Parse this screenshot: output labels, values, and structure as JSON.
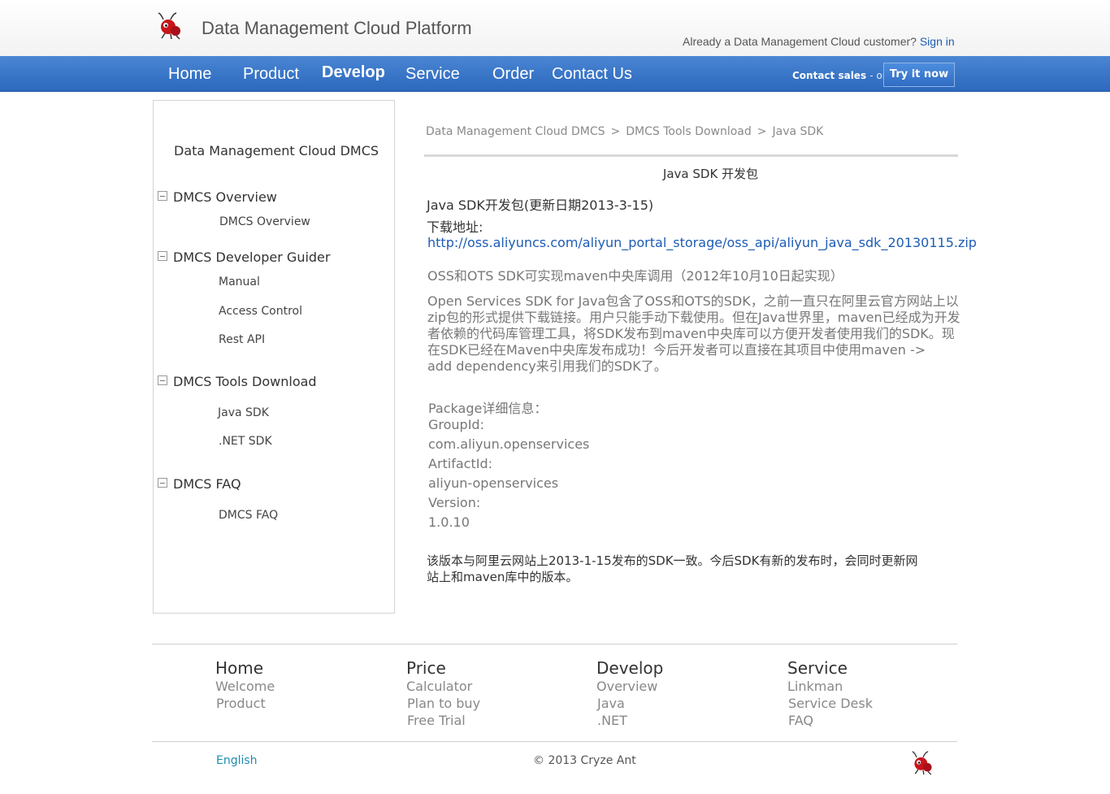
{
  "header": {
    "brand": "Data Management Cloud Platform",
    "signin_prompt": "Already a Data Management Cloud customer?",
    "signin_link": "Sign in"
  },
  "nav": {
    "items": [
      "Home",
      "Product",
      "Develop",
      "Service",
      "Order",
      "Contact Us"
    ],
    "active": "Develop",
    "contact_sales": "Contact sales",
    "or": "- or -",
    "try_button": "Try it now",
    "bar_color": "#2c68bd"
  },
  "sidebar": {
    "title": "Data Management Cloud DMCS",
    "sections": [
      {
        "label": "DMCS Overview",
        "links": [
          "DMCS Overview"
        ]
      },
      {
        "label": "DMCS Developer Guider",
        "links": [
          "Manual",
          "Access Control",
          "Rest API"
        ]
      },
      {
        "label": "DMCS Tools Download",
        "links": [
          "Java SDK",
          ".NET SDK"
        ]
      },
      {
        "label": "DMCS FAQ",
        "links": [
          "DMCS FAQ"
        ]
      }
    ]
  },
  "main": {
    "breadcrumb": [
      "Data Management Cloud DMCS",
      "DMCS Tools Download",
      "Java SDK"
    ],
    "breadcrumb_sep": ">",
    "page_title": "Java SDK 开发包",
    "package_heading": "Java SDK开发包(更新日期2013-3-15)",
    "download_label": "下载地址:",
    "download_url": "http://oss.aliyuncs.com/aliyun_portal_storage/oss_api/aliyun_java_sdk_20130115.zip",
    "maven_note": "OSS和OTS SDK可实现maven中央库调用（2012年10月10日起实现）",
    "description_lines": [
      "Open Services SDK for Java包含了OSS和OTS的SDK，之前一直只在阿里云官方网站上以",
      "zip包的形式提供下载链接。用户只能手动下载使用。但在Java世界里，maven已经成为开发",
      "者依赖的代码库管理工具，将SDK发布到maven中央库可以方便开发者使用我们的SDK。现",
      "在SDK已经在Maven中央库发布成功！今后开发者可以直接在其项目中使用maven ->",
      "add dependency来引用我们的SDK了。"
    ],
    "package_details": [
      "Package详细信息：",
      "GroupId:",
      "com.aliyun.openservices",
      "ArtifactId:",
      "aliyun-openservices",
      "Version:",
      "1.0.10"
    ],
    "closing_lines": [
      "该版本与阿里云网站上2013-1-15发布的SDK一致。今后SDK有新的发布时，会同时更新网",
      "站上和maven库中的版本。"
    ]
  },
  "footer": {
    "columns": [
      {
        "heading": "Home",
        "links": [
          "Welcome",
          "Product"
        ]
      },
      {
        "heading": "Price",
        "links": [
          "Calculator",
          "Plan to buy",
          "Free Trial"
        ]
      },
      {
        "heading": "Develop",
        "links": [
          "Overview",
          "Java",
          ".NET"
        ]
      },
      {
        "heading": "Service",
        "links": [
          "Linkman",
          "Service Desk",
          "FAQ"
        ]
      }
    ],
    "language": "English",
    "copyright": "© 2013 Cryze Ant"
  }
}
